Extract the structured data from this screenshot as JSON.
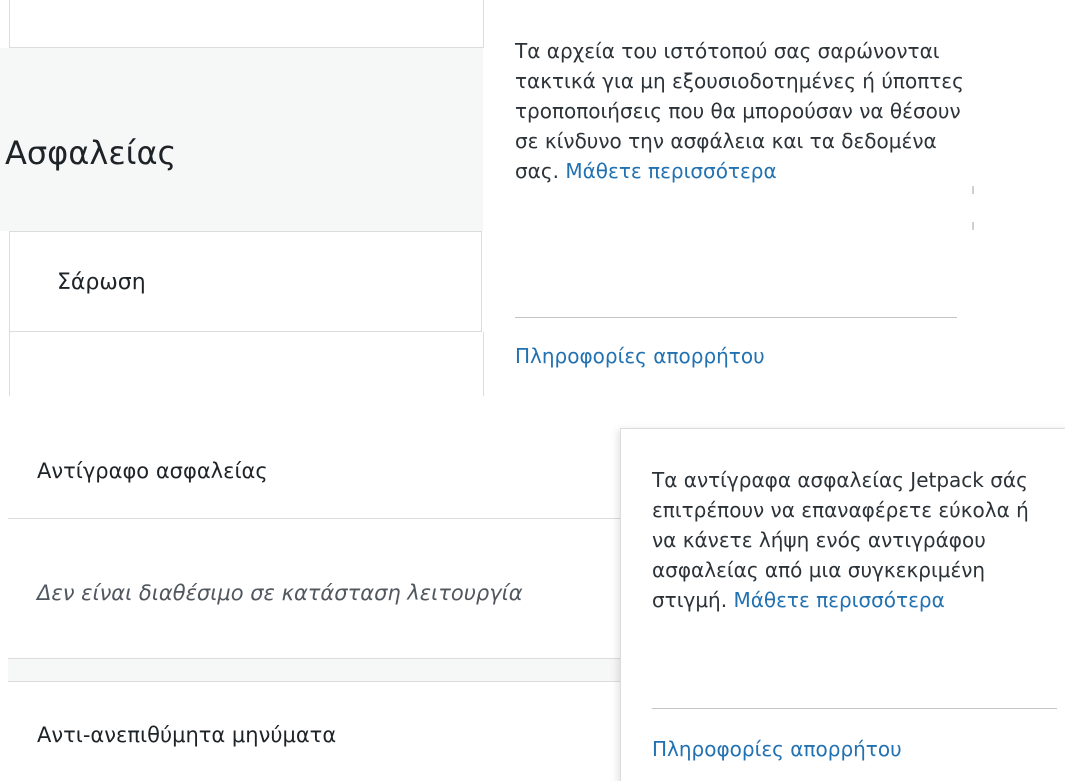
{
  "security_section": {
    "title": "Ασφαλείας",
    "scan_label": "Σάρωση",
    "scan_tooltip": {
      "text": "Τα αρχεία του ιστότοπού σας σαρώνονται τακτικά για μη εξουσιοδοτημένες ή ύποπτες τροποποιήσεις που θα μπορούσαν να θέσουν σε κίνδυνο την ασφάλεια και τα δεδομένα σας.",
      "learn_more": "Μάθετε περισσότερα",
      "privacy_link": "Πληροφορίες απορρήτου"
    }
  },
  "backup": {
    "label": "Αντίγραφο ασφαλείας",
    "unavailable_text": "Δεν είναι διαθέσιμο σε κατάσταση λειτουργία",
    "tooltip": {
      "text": "Τα αντίγραφα ασφαλείας Jetpack σάς επιτρέπουν να επαναφέρετε εύκολα ή να κάνετε λήψη ενός αντιγράφου ασφαλείας από μια συγκεκριμένη στιγμή.",
      "learn_more": "Μάθετε περισσότερα",
      "privacy_link": "Πληροφορίες απορρήτου"
    }
  },
  "antispam": {
    "label": "Αντι-ανεπιθύμητα μηνύματα"
  },
  "colors": {
    "link": "#2271b1",
    "text": "#2c3338",
    "heading": "#1d2327",
    "band": "#f6f7f7",
    "border": "#dcdcde"
  }
}
